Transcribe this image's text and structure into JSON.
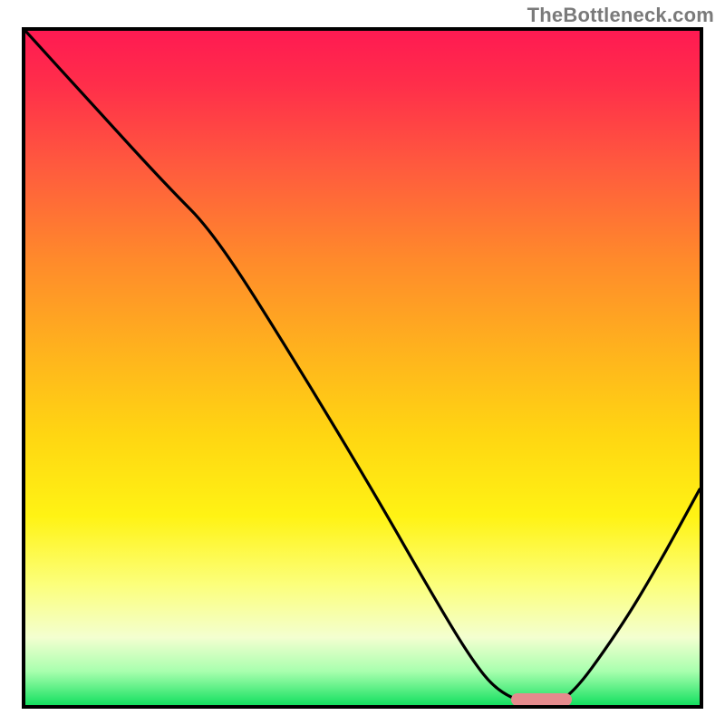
{
  "watermark": "TheBottleneck.com",
  "chart_data": {
    "type": "line",
    "title": "",
    "xlabel": "",
    "ylabel": "",
    "xlim": [
      0,
      100
    ],
    "ylim": [
      0,
      100
    ],
    "grid": false,
    "series": [
      {
        "name": "curve",
        "x": [
          0,
          10,
          21,
          28,
          40,
          52,
          60,
          66,
          70,
          75,
          80,
          88,
          94,
          100
        ],
        "y": [
          100,
          89,
          77,
          70,
          51,
          31,
          17,
          7,
          2,
          0,
          0,
          11,
          21,
          32
        ]
      }
    ],
    "annotations": [
      {
        "name": "minimum-marker",
        "x_range": [
          72,
          81
        ],
        "y": 0.8
      }
    ],
    "colors": {
      "curve": "#000000",
      "marker": "#e58b8d",
      "gradient_top": "#ff1a52",
      "gradient_mid": "#ffd612",
      "gradient_bottom": "#14e060"
    }
  }
}
